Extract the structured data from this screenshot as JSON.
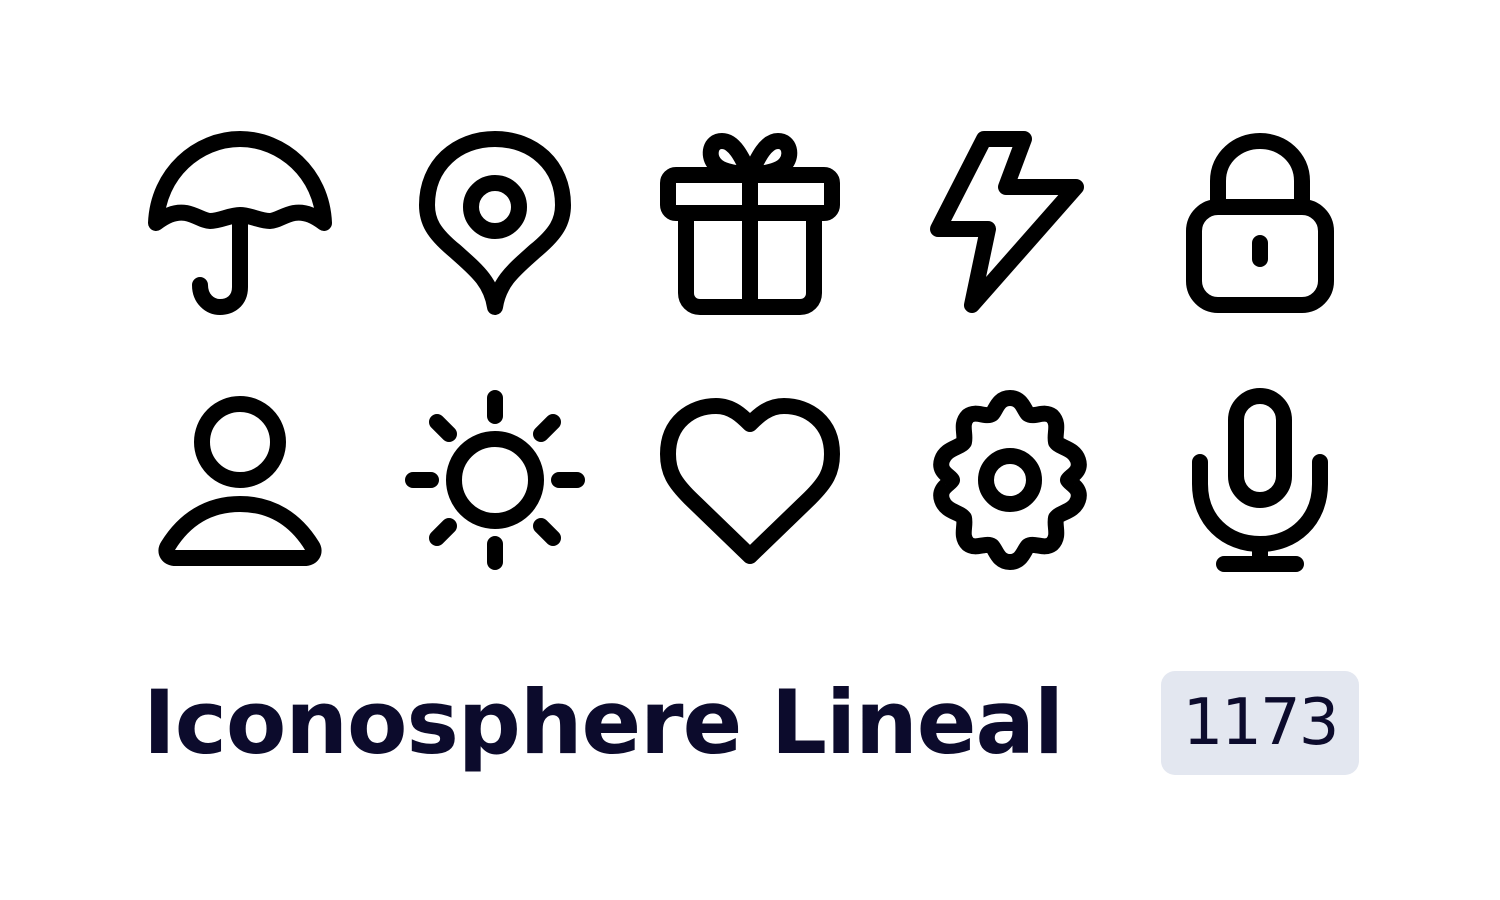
{
  "title": "Iconosphere Lineal",
  "icon_count": "1173",
  "icons": [
    "umbrella-icon",
    "map-pin-icon",
    "gift-icon",
    "lightning-bolt-icon",
    "lock-icon",
    "user-icon",
    "sun-icon",
    "heart-icon",
    "gear-icon",
    "microphone-icon"
  ],
  "colors": {
    "background": "#ffffff",
    "icon_stroke": "#000000",
    "text": "#0c0b2c",
    "badge_background": "#e3e7f0"
  }
}
